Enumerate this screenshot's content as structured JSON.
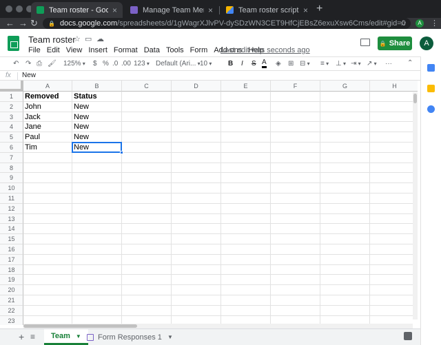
{
  "browser": {
    "tabs": [
      {
        "label": "Team roster - Google Sheets",
        "icon": "sheets-icon",
        "active": true
      },
      {
        "label": "Manage Team Members",
        "icon": "forms-icon",
        "active": false
      },
      {
        "label": "Team roster script",
        "icon": "apps-script-icon",
        "active": false
      }
    ],
    "new_tab": "+",
    "url_host": "docs.google.com",
    "url_path": "/spreadsheets/d/1gWagrXJlvPV-dySDzWN3CET9HfCjEBsZ6exuXsw6Cms/edit#gid=0",
    "profile_initial": "A"
  },
  "header": {
    "title": "Team roster",
    "menu": [
      "File",
      "Edit",
      "View",
      "Insert",
      "Format",
      "Data",
      "Tools",
      "Form",
      "Add-ons",
      "Help"
    ],
    "last_edit": "Last edit was seconds ago",
    "share_label": "Share",
    "avatar_initial": "A"
  },
  "toolbar": {
    "zoom": "125%",
    "currency": "$",
    "percent": "%",
    "dec_decrease": ".0",
    "dec_increase": ".00",
    "more_formats": "123",
    "font": "Default (Ari...",
    "font_size": "10",
    "bold": "B",
    "italic": "I",
    "strike": "S",
    "text_color": "A",
    "more": "···"
  },
  "formula_bar": {
    "fx": "fx",
    "value": "New"
  },
  "grid": {
    "columns": [
      "A",
      "B",
      "C",
      "D",
      "E",
      "F",
      "G",
      "H"
    ],
    "row_numbers": [
      "1",
      "2",
      "3",
      "4",
      "5",
      "6",
      "7",
      "8",
      "9",
      "10",
      "11",
      "12",
      "13",
      "14",
      "15",
      "16",
      "17",
      "18",
      "19",
      "20",
      "21",
      "22",
      "23"
    ],
    "rows": [
      [
        "Removed",
        "Status"
      ],
      [
        "John",
        "New"
      ],
      [
        "Jack",
        "New"
      ],
      [
        "Jane",
        "New"
      ],
      [
        "Paul",
        "New"
      ],
      [
        "Tim",
        "New"
      ]
    ],
    "selected_cell": "B6"
  },
  "sheets": {
    "tabs": [
      {
        "label": "Team",
        "active": true
      },
      {
        "label": "Form Responses 1",
        "active": false
      }
    ]
  },
  "colors": {
    "accent": "#1a73e8",
    "share": "#1e8e3e",
    "sheets_green": "#0f9d58"
  }
}
